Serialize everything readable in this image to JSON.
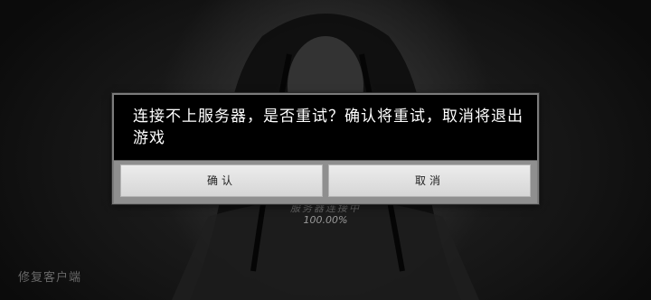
{
  "dialog": {
    "message": "连接不上服务器，是否重试？确认将重试，取消将退出游戏",
    "confirm_label": "确认",
    "cancel_label": "取消"
  },
  "loading": {
    "status_text": "服务器连接中",
    "percent_text": "100.00%"
  },
  "footer": {
    "label": "修复客户端"
  }
}
